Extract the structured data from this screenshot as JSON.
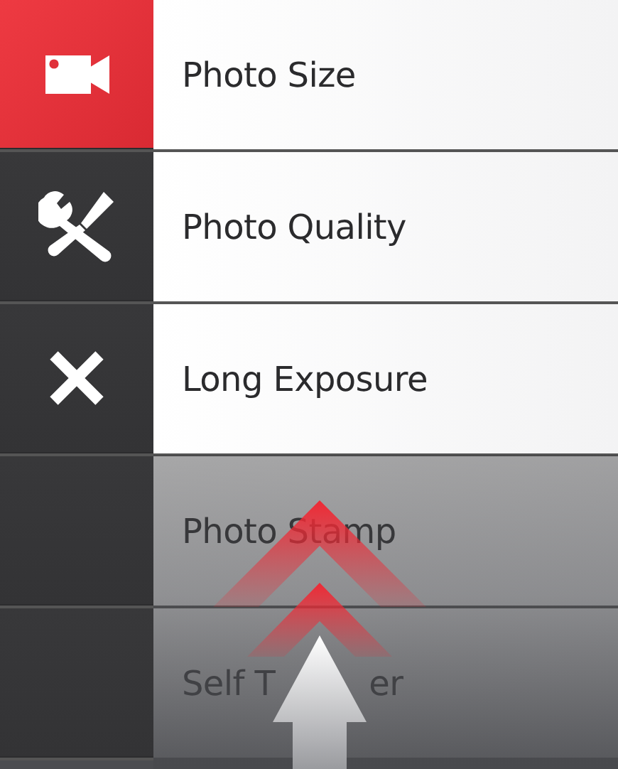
{
  "menu": {
    "items": [
      {
        "label": "Photo Size",
        "kind": "camera",
        "selected": true
      },
      {
        "label": "Photo Quality",
        "kind": "tools",
        "selected": false
      },
      {
        "label": "Long Exposure",
        "kind": "close",
        "selected": false
      },
      {
        "label": "Photo Stamp",
        "kind": "none",
        "selected": false
      },
      {
        "label": "Self T",
        "label_end": "er",
        "kind": "none",
        "selected": false
      }
    ]
  },
  "overlay": {
    "kind": "swipe-up"
  }
}
